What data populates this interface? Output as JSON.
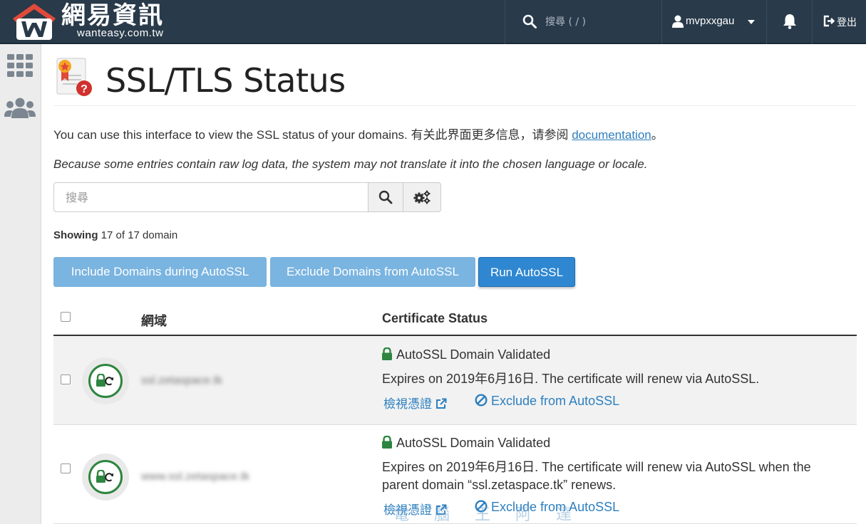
{
  "brand": {
    "title": "網易資訊",
    "subtitle": "wanteasy.com.tw"
  },
  "topbar": {
    "search_placeholder": "搜尋 ( / )",
    "username": "mvpxxgau",
    "logout_label": "登出"
  },
  "page": {
    "title": "SSL/TLS Status",
    "intro_text": "You can use this interface to view the SSL status of your domains. 有关此界面更多信息，请参阅 ",
    "intro_link": "documentation",
    "intro_end": "。",
    "note": "Because some entries contain raw log data, the system may not translate it into the chosen language or locale.",
    "search_placeholder": "搜尋",
    "showing_label": "Showing",
    "showing_value": "17 of 17 domain"
  },
  "actions": {
    "include_label": "Include Domains during AutoSSL",
    "exclude_label": "Exclude Domains from AutoSSL",
    "run_label": "Run AutoSSL"
  },
  "table": {
    "columns": [
      "網域",
      "Certificate Status"
    ],
    "rows": [
      {
        "domain": "ssl.zetaspace.tk",
        "status": "AutoSSL Domain Validated",
        "expires": "Expires on 2019年6月16日. The certificate will renew via AutoSSL.",
        "view_label": "檢視憑證",
        "exclude_label": "Exclude from AutoSSL"
      },
      {
        "domain": "www.ssl.zetaspace.tk",
        "status": "AutoSSL Domain Validated",
        "expires": "Expires on 2019年6月16日. The certificate will renew via AutoSSL when the parent domain “ssl.zetaspace.tk” renews.",
        "view_label": "檢視憑證",
        "exclude_label": "Exclude from AutoSSL"
      }
    ]
  },
  "watermark": "電 腦 王 阿 達",
  "colors": {
    "topbar": "#293a4a",
    "button_light": "#7ab4e0",
    "button_primary": "#2f87d1",
    "link": "#2d7fbf",
    "validated_green": "#2e8540",
    "logo_red": "#e04a3a"
  }
}
